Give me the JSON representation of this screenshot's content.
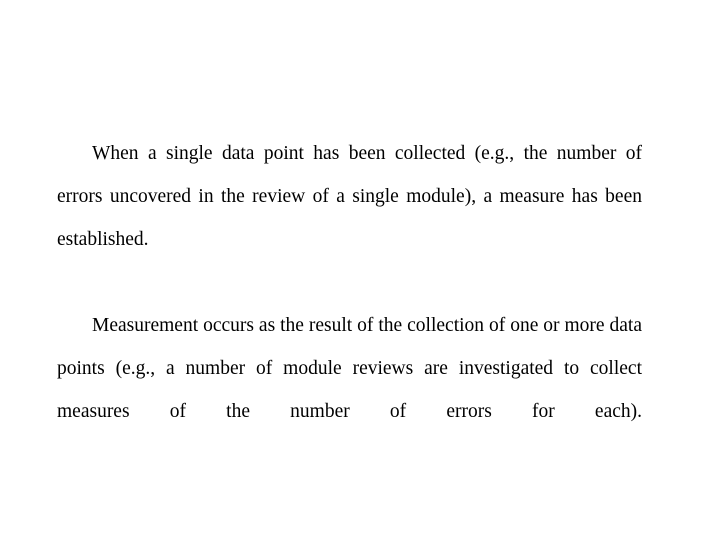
{
  "slide": {
    "background_color": "#ffffff",
    "text_color": "#000000",
    "paragraphs": [
      {
        "id": "paragraph-measure",
        "text": "When a single data point has been collected (e.g., the number of errors uncovered in the review of a single module), a measure has been established."
      },
      {
        "id": "paragraph-measurement",
        "text": "Measurement occurs as the result of the collection of one or more data points (e.g., a number of module reviews are investigated to collect measures of the number of errors for each)."
      }
    ]
  }
}
